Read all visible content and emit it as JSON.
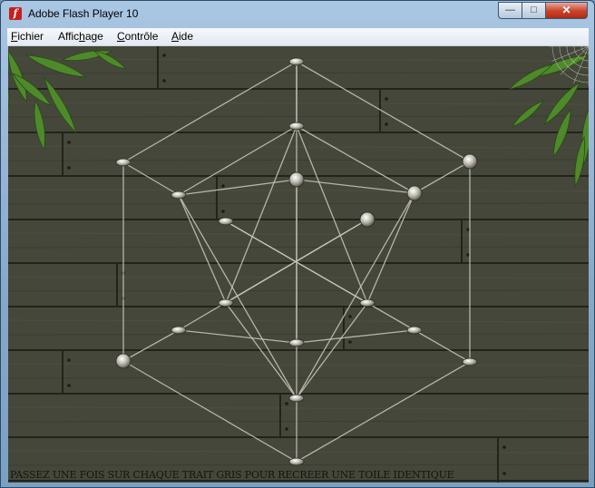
{
  "window": {
    "title": "Adobe Flash Player 10",
    "buttons": {
      "minimize": "—",
      "maximize": "□",
      "close": "✕"
    }
  },
  "menu": [
    {
      "label": "Fichier",
      "accelerator": "F"
    },
    {
      "label": "Affichage",
      "accelerator": "h"
    },
    {
      "label": "Contrôle",
      "accelerator": "C"
    },
    {
      "label": "Aide",
      "accelerator": "A"
    }
  ],
  "game": {
    "instruction": "PASSEZ UNE FOIS SUR CHAQUE TRAIT GRIS POUR RECREER UNE TOILE IDENTIQUE",
    "background": "wooden planks",
    "colors": {
      "wood": "#3e4034",
      "thread": "#c9c8bd",
      "node": "#d4d2c6",
      "leaf": "#4f8a2a"
    }
  }
}
